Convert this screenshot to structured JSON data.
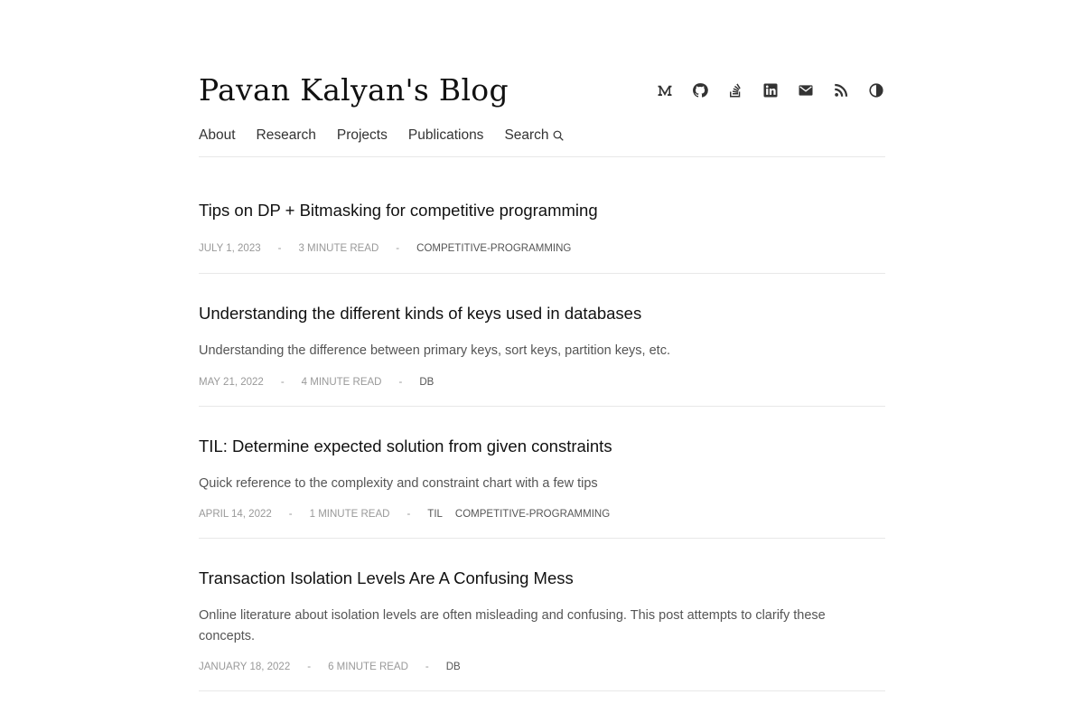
{
  "site": {
    "title": "Pavan Kalyan's Blog"
  },
  "nav": {
    "items": [
      {
        "label": "About"
      },
      {
        "label": "Research"
      },
      {
        "label": "Projects"
      },
      {
        "label": "Publications"
      },
      {
        "label": "Search"
      }
    ]
  },
  "social_icons": [
    "medium-icon",
    "github-icon",
    "stackoverflow-icon",
    "linkedin-icon",
    "email-icon",
    "rss-icon",
    "theme-toggle-icon"
  ],
  "posts": [
    {
      "title": "Tips on DP + Bitmasking for competitive programming",
      "excerpt": "",
      "date": "JULY 1, 2023",
      "sep": "-",
      "read_time": "3 MINUTE READ",
      "tags": [
        "COMPETITIVE-PROGRAMMING"
      ]
    },
    {
      "title": "Understanding the different kinds of keys used in databases",
      "excerpt": "Understanding the difference between primary keys, sort keys, partition keys, etc.",
      "date": "MAY 21, 2022",
      "sep": "-",
      "read_time": "4 MINUTE READ",
      "tags": [
        "DB"
      ]
    },
    {
      "title": "TIL: Determine expected solution from given constraints",
      "excerpt": "Quick reference to the complexity and constraint chart with a few tips",
      "date": "APRIL 14, 2022",
      "sep": "-",
      "read_time": "1 MINUTE READ",
      "tags": [
        "TIL",
        "COMPETITIVE-PROGRAMMING"
      ]
    },
    {
      "title": "Transaction Isolation Levels Are A Confusing Mess",
      "excerpt": "Online literature about isolation levels are often misleading and confusing. This post attempts to clarify these concepts.",
      "date": "JANUARY 18, 2022",
      "sep": "-",
      "read_time": "6 MINUTE READ",
      "tags": [
        "DB"
      ]
    }
  ]
}
